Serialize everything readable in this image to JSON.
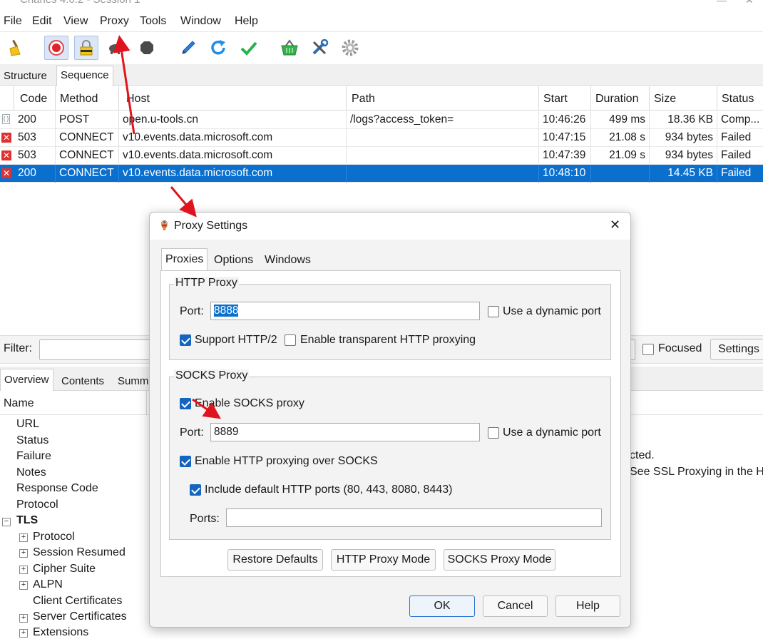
{
  "window": {
    "title": "Charles 4.6.2 - Session 1"
  },
  "menu": [
    "File",
    "Edit",
    "View",
    "Proxy",
    "Tools",
    "Window",
    "Help"
  ],
  "toolbar": [
    {
      "icon": "broom-icon"
    },
    {
      "icon": "record-icon"
    },
    {
      "icon": "lock-icon"
    },
    {
      "icon": "turtle-icon"
    },
    {
      "icon": "stop-icon"
    },
    {
      "icon": "pen-icon"
    },
    {
      "icon": "refresh-icon"
    },
    {
      "icon": "check-icon"
    },
    {
      "icon": "basket-icon"
    },
    {
      "icon": "tools-icon"
    },
    {
      "icon": "gear-icon"
    }
  ],
  "session_tabs": [
    "Structure",
    "Sequence"
  ],
  "table": {
    "headers": [
      "Code",
      "Method",
      "Host",
      "Path",
      "Start",
      "Duration",
      "Size",
      "Status"
    ],
    "rows": [
      {
        "code": "200",
        "method": "POST",
        "host": "open.u-tools.cn",
        "path": "/logs?access_token=",
        "start": "10:46:26",
        "duration": "499 ms",
        "size": "18.36 KB",
        "status": "Comp..."
      },
      {
        "code": "503",
        "method": "CONNECT",
        "host": "v10.events.data.microsoft.com",
        "path": "",
        "start": "10:47:15",
        "duration": "21.08 s",
        "size": "934 bytes",
        "status": "Failed"
      },
      {
        "code": "503",
        "method": "CONNECT",
        "host": "v10.events.data.microsoft.com",
        "path": "",
        "start": "10:47:39",
        "duration": "21.09 s",
        "size": "934 bytes",
        "status": "Failed"
      },
      {
        "code": "200",
        "method": "CONNECT",
        "host": "v10.events.data.microsoft.com",
        "path": "",
        "start": "10:48:10",
        "duration": "",
        "size": "14.45 KB",
        "status": "Failed"
      }
    ]
  },
  "filter": {
    "label": "Filter:",
    "value": "",
    "focused_label": "Focused",
    "settings_label": "Settings"
  },
  "detail_tabs": [
    "Overview",
    "Contents",
    "Summ"
  ],
  "detail": {
    "name_header": "Name",
    "items": [
      "URL",
      "Status",
      "Failure",
      "Notes",
      "Response Code",
      "Protocol"
    ],
    "tls": "TLS",
    "tls_items": [
      "Protocol",
      "Session Resumed",
      "Cipher Suite",
      "ALPN",
      "Client Certificates",
      "Server Certificates",
      "Extensions"
    ],
    "right_snippets": [
      "cted.",
      "See SSL Proxying in the H"
    ]
  },
  "dialog": {
    "title": "Proxy Settings",
    "tabs": [
      "Proxies",
      "Options",
      "Windows"
    ],
    "http_proxy": {
      "group_label": "HTTP Proxy",
      "port_label": "Port:",
      "port_value": "8888",
      "dynamic_port_label": "Use a dynamic port",
      "support_http2_label": "Support HTTP/2",
      "transparent_label": "Enable transparent HTTP proxying"
    },
    "socks_proxy": {
      "group_label": "SOCKS Proxy",
      "enable_label": "Enable SOCKS proxy",
      "port_label": "Port:",
      "port_value": "8889",
      "dynamic_port_label": "Use a dynamic port",
      "http_over_socks_label": "Enable HTTP proxying over SOCKS",
      "include_ports_label": "Include default HTTP ports (80, 443, 8080, 8443)",
      "ports_label": "Ports:",
      "ports_value": ""
    },
    "buttons": {
      "restore": "Restore Defaults",
      "http_mode": "HTTP Proxy Mode",
      "socks_mode": "SOCKS Proxy Mode",
      "ok": "OK",
      "cancel": "Cancel",
      "help": "Help"
    }
  },
  "colors": {
    "selection": "#0b6fce",
    "annotation_arrow": "#e0141e",
    "checkbox": "#1464c0"
  }
}
